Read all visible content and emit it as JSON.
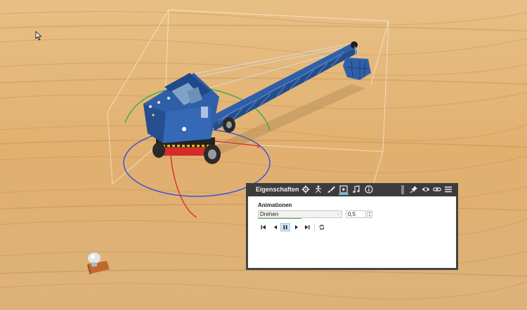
{
  "panel": {
    "title": "Eigenschaften",
    "section_title": "Animationen",
    "animation_select": {
      "value": "Drehen"
    },
    "speed_input": {
      "value": "0,5"
    },
    "header_icons": [
      "gear-icon",
      "skeleton-icon",
      "brush-icon",
      "animation-icon",
      "music-icon",
      "info-icon",
      "pin-icon",
      "eye-icon",
      "link-icon",
      "menu-icon"
    ],
    "transport": [
      "skip-to-start",
      "step-back",
      "pause",
      "step-forward",
      "skip-to-end",
      "loop"
    ]
  },
  "colors": {
    "wood_light": "#ecc58d",
    "wood_dark": "#c9924c",
    "crane_blue": "#2f5fa8",
    "crane_red": "#d22d28",
    "gizmo_red": "#e0312d",
    "gizmo_green": "#3bb34a",
    "gizmo_blue": "#3a55d8",
    "panel_dark": "#3c3c3c",
    "accent": "#4fc3f7",
    "selection_green": "#4caf50"
  }
}
